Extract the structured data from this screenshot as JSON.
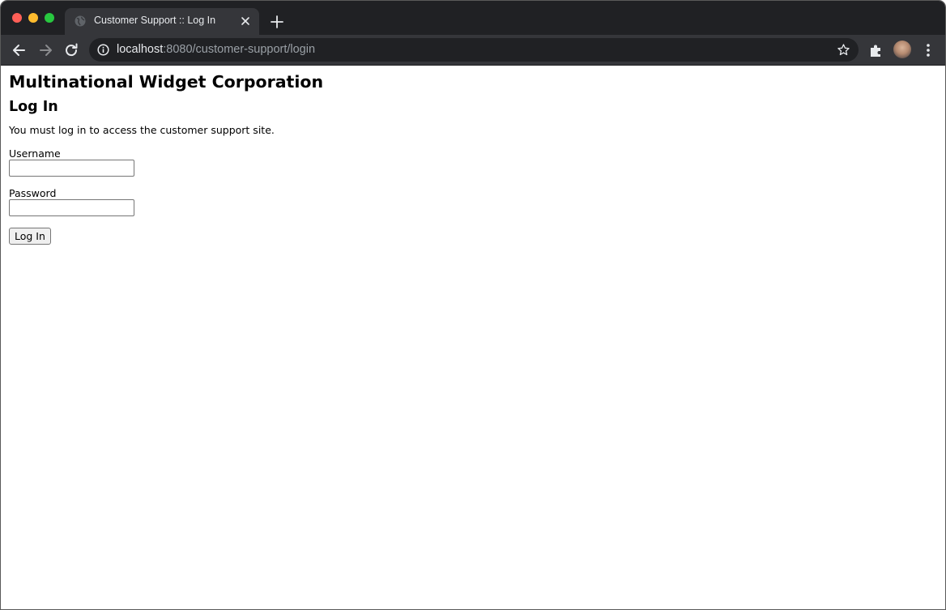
{
  "browser": {
    "tab": {
      "title": "Customer Support :: Log In",
      "favicon": "globe-icon"
    },
    "toolbar": {
      "url_host": "localhost",
      "url_rest": ":8080/customer-support/login",
      "icons": [
        "back-arrow-icon",
        "forward-arrow-icon",
        "reload-icon",
        "info-icon",
        "star-icon",
        "extensions-puzzle-icon",
        "avatar",
        "kebab-menu-icon"
      ]
    },
    "colors": {
      "titlebar": "#202124",
      "toolbar": "#35363a",
      "omnibox": "#202124",
      "close_dot": "#ff5f57",
      "minimize_dot": "#febc2e",
      "maximize_dot": "#28c840"
    }
  },
  "page": {
    "company_name": "Multinational Widget Corporation",
    "title": "Log In",
    "intro": "You must log in to access the customer support site.",
    "form": {
      "username_label": "Username",
      "username_value": "",
      "password_label": "Password",
      "password_value": "",
      "submit_label": "Log In"
    }
  }
}
